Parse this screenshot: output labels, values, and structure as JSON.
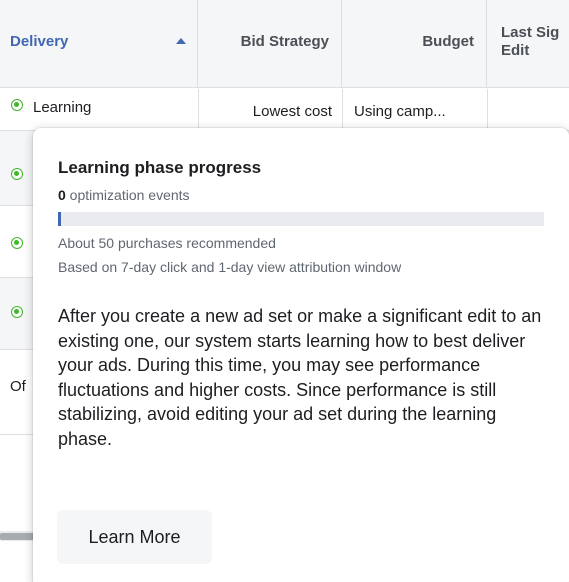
{
  "table": {
    "headers": {
      "delivery": "Delivery",
      "bid_strategy": "Bid Strategy",
      "budget": "Budget",
      "last_significant_edit": "Last Sig\nEdit"
    },
    "rows": [
      {
        "delivery": "Learning",
        "bid_strategy": "Lowest cost",
        "budget": "Using camp..."
      },
      {
        "delivery": ""
      },
      {
        "delivery": ""
      },
      {
        "delivery": ""
      },
      {
        "delivery": "Of"
      }
    ]
  },
  "tooltip": {
    "title": "Learning phase progress",
    "events_count": "0",
    "events_label": " optimization events",
    "progress_fraction": 0.0,
    "recommendation": "About 50 purchases recommended",
    "attribution": "Based on 7-day click and 1-day view attribution window",
    "body": "After you create a new ad set or make a significant edit to an existing one, our system starts learning how to best deliver your ads. During this time, you may see performance fluctuations and higher costs. Since performance is still stabilizing, avoid editing your ad set during the learning phase.",
    "button_label": "Learn More"
  },
  "colors": {
    "accent": "#4267b2",
    "status_active": "#42b72a",
    "header_bg": "#f5f6f7",
    "border": "#dddfe2"
  },
  "icons": {
    "sort": "sort-ascending-icon",
    "status": "status-dot-icon"
  }
}
